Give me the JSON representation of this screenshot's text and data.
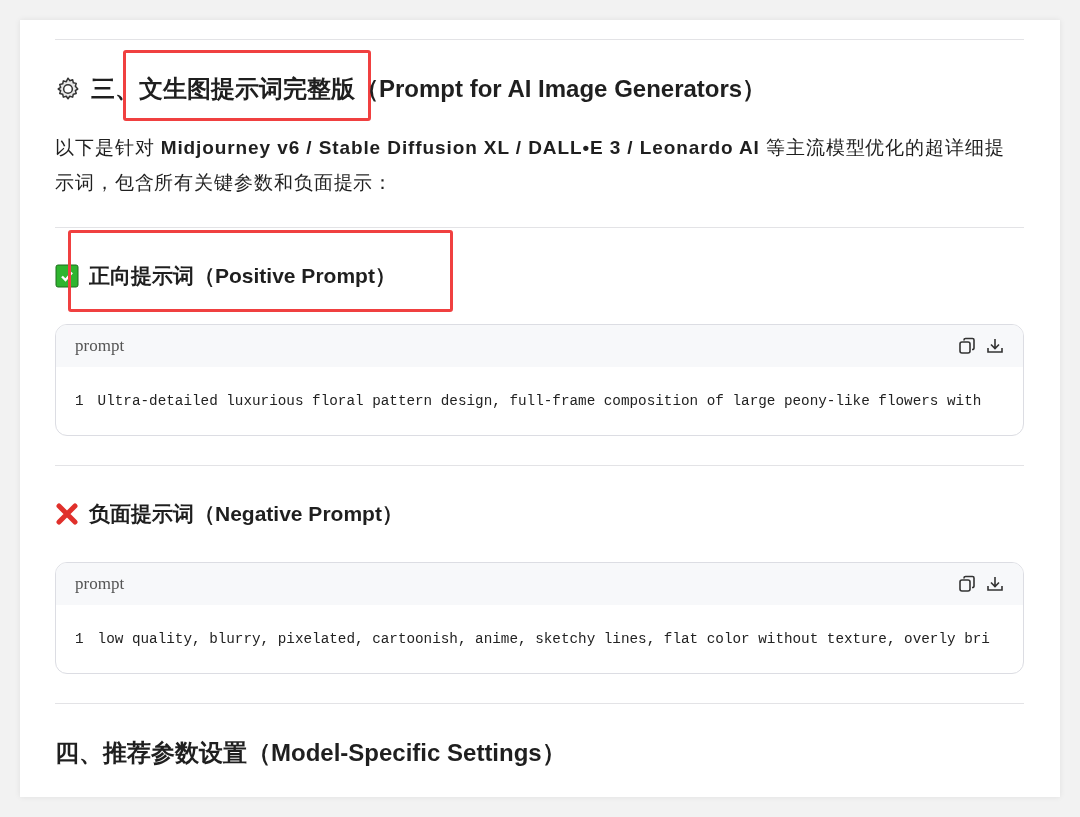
{
  "blocks": [
    {
      "kind": "gear_heading",
      "segments": [
        {
          "text": "三、",
          "highlighted": false
        },
        {
          "text": "文生图提示词完整版",
          "highlighted": true
        },
        {
          "text": "（Prompt for AI Image Generators）",
          "highlighted": false
        }
      ]
    },
    {
      "kind": "paragraph",
      "text": "以下是针对 **Midjourney v6 / Stable Diffusion XL / DALL•E 3 / Leonardo AI** 等主流模型优化的超详细提示词，包含所有关键参数和负面提示："
    },
    {
      "kind": "check_subheading",
      "segments": [
        {
          "text": "正向提示词（Positive Prompt）",
          "highlighted": true
        }
      ]
    },
    {
      "kind": "code",
      "language": "prompt",
      "lines": [
        {
          "number": "1",
          "text": "Ultra-detailed luxurious floral pattern design, full-frame composition of large peony-like flowers with"
        }
      ]
    },
    {
      "kind": "cross_subheading",
      "segments": [
        {
          "text": "负面提示词（Negative Prompt）",
          "highlighted": false
        }
      ]
    },
    {
      "kind": "code",
      "language": "prompt",
      "lines": [
        {
          "number": "1",
          "text": "low quality, blurry, pixelated, cartoonish, anime, sketchy lines, flat color without texture, overly bri"
        }
      ]
    },
    {
      "kind": "heading",
      "segments": [
        {
          "text": "四、推荐参数设置（Model-Specific Settings）",
          "highlighted": false
        }
      ]
    }
  ]
}
